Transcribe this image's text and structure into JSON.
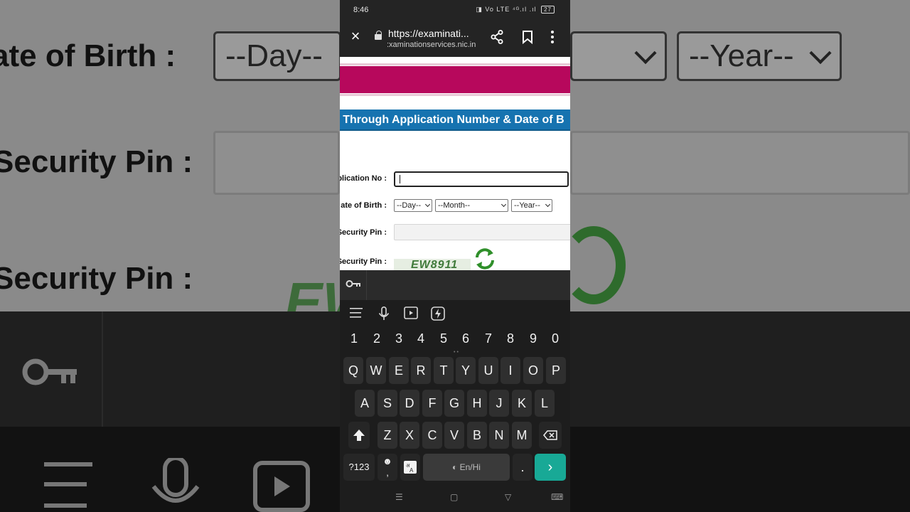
{
  "status_bar": {
    "time": "8:46",
    "system_icons": "◨ Vo LTE ⁴ᴳ.ıl .ıl",
    "battery": "27"
  },
  "browser": {
    "url_main": "https://examinati...",
    "url_domain": ":xaminationservices.nic.in",
    "close_icon": "close-icon",
    "share_icon": "share-icon",
    "bookmark_icon": "bookmark-icon",
    "more_icon": "more-vertical-icon"
  },
  "page": {
    "heading": "n Through Application Number & Date of B",
    "app_no_label": "plication No :",
    "app_no_value": "",
    "dob_label": "ate of Birth :",
    "dob_day": "--Day--",
    "dob_month": "--Month--",
    "dob_year": "--Year--",
    "enter_pin_label": "Security Pin :",
    "captcha_pin_label": "Security Pin :",
    "captcha_text": "EW8911",
    "colors": {
      "banner": "#b7085c",
      "heading_bar": "#1673b0"
    }
  },
  "background": {
    "dob_label": "ate of Birth :",
    "day": "--Day--",
    "year": "--Year--",
    "pin_label_1": "Security Pin :",
    "pin_label_2": "Security Pin :",
    "captcha_fragment": "EW"
  },
  "keyboard": {
    "numbers": [
      "1",
      "2",
      "3",
      "4",
      "5",
      "6",
      "7",
      "8",
      "9",
      "0"
    ],
    "row1": [
      "Q",
      "W",
      "E",
      "R",
      "T",
      "Y",
      "U",
      "I",
      "O",
      "P"
    ],
    "row2": [
      "A",
      "S",
      "D",
      "F",
      "G",
      "H",
      "J",
      "K",
      "L"
    ],
    "row3": [
      "Z",
      "X",
      "C",
      "V",
      "B",
      "N",
      "M"
    ],
    "symbols_label": "?123",
    "emoji_label": ",",
    "space_label": "En/Hi",
    "period_label": ".",
    "enter_color": "#18a996"
  }
}
